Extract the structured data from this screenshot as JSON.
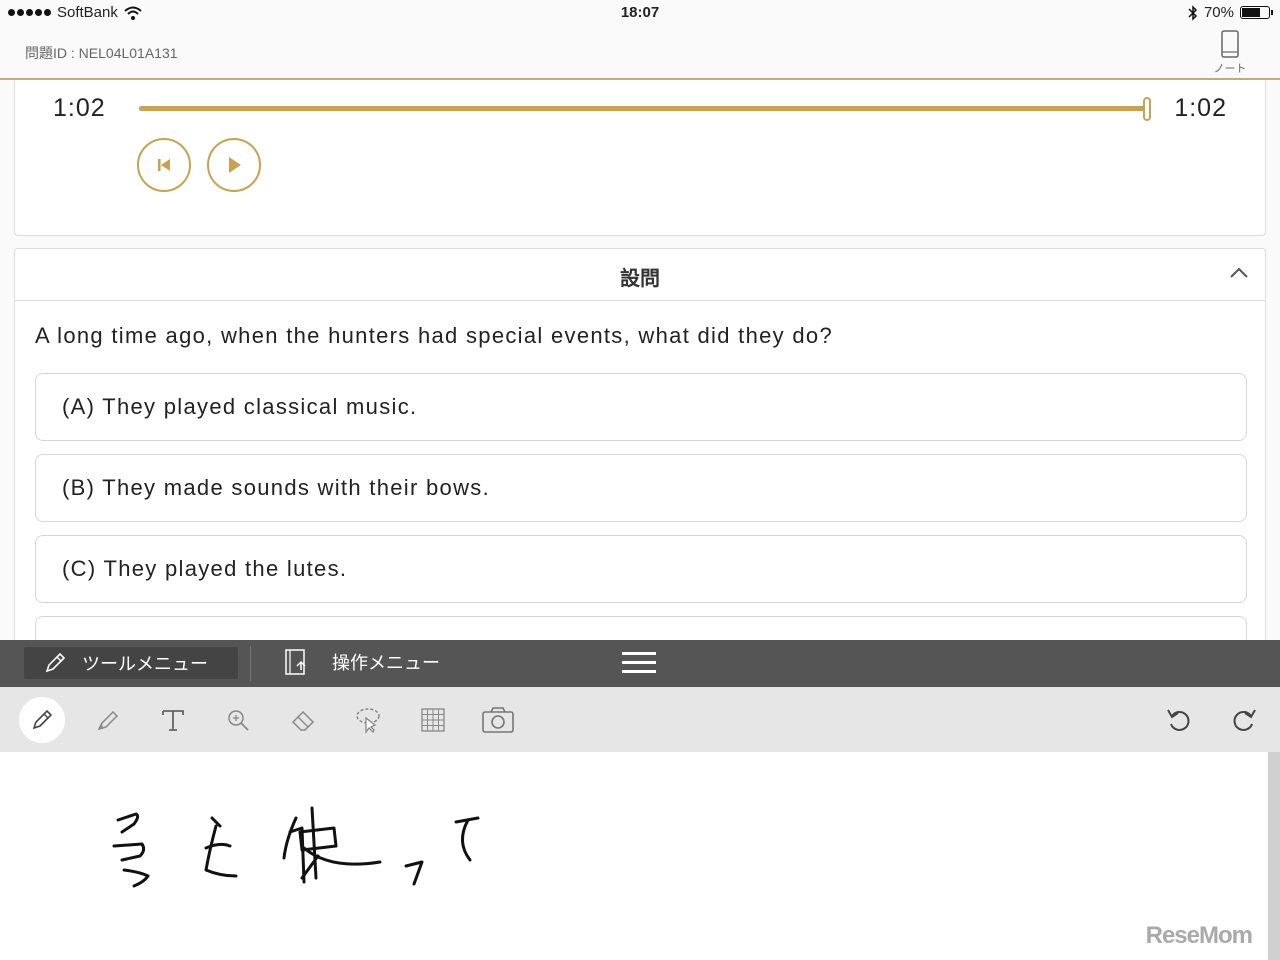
{
  "status": {
    "carrier": "SoftBank",
    "time": "18:07",
    "battery": "70%",
    "battery_level": 0.7
  },
  "header": {
    "problem_id": "問題ID : NEL04L01A131",
    "note_label": "ノート"
  },
  "player": {
    "current_time": "1:02",
    "total_time": "1:02",
    "progress": 1.0
  },
  "question": {
    "section_title": "設問",
    "text": "A long time ago, when the hunters had special events, what did they do?",
    "options": [
      "(A) They played classical music.",
      "(B) They made sounds with their bows.",
      "(C) They played the lutes.",
      ""
    ]
  },
  "menu": {
    "tool_menu": "ツールメニュー",
    "operation_menu": "操作メニュー"
  },
  "tools": [
    "pen-icon",
    "highlighter-icon",
    "text-icon",
    "zoom-icon",
    "eraser-icon",
    "lasso-icon",
    "grid-icon",
    "camera-icon",
    "undo-icon",
    "redo-icon"
  ],
  "watermark": "ReseMom",
  "colors": {
    "accent": "#c6a253",
    "menu_bar": "#555555",
    "toolbar": "#e6e6e6"
  }
}
